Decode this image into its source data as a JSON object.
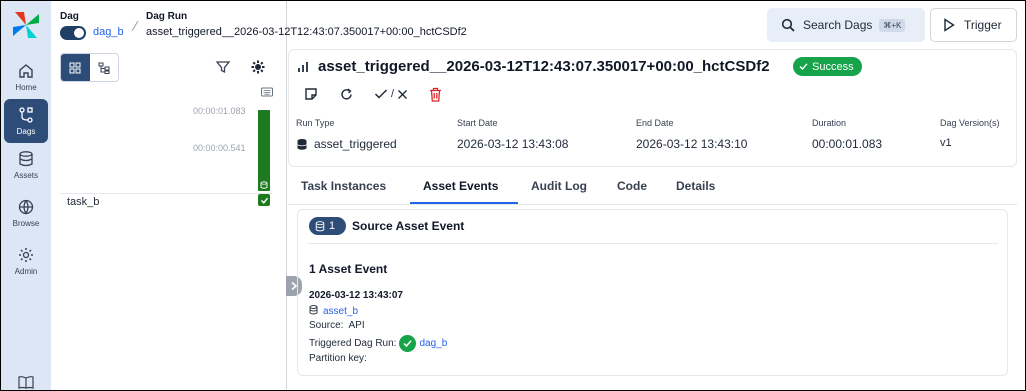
{
  "nav": {
    "items": [
      {
        "label": "Home",
        "icon": "home-icon"
      },
      {
        "label": "Dags",
        "icon": "dags-icon"
      },
      {
        "label": "Assets",
        "icon": "database-icon"
      },
      {
        "label": "Browse",
        "icon": "globe-icon"
      },
      {
        "label": "Admin",
        "icon": "gear-icon"
      }
    ],
    "bottom_icon": "book-icon"
  },
  "breadcrumb": {
    "dag_label": "Dag",
    "dag_name": "dag_b",
    "run_label": "Dag Run",
    "run_id": "asset_triggered__2026-03-12T12:43:07.350017+00:00_hctCSDf2"
  },
  "grid": {
    "durations": [
      "00:00:01.083",
      "00:00:00.541"
    ],
    "tasks": [
      {
        "name": "task_b",
        "state": "success"
      }
    ]
  },
  "topbar": {
    "search_label": "Search Dags",
    "search_shortcut": "⌘+K",
    "trigger_label": "Trigger"
  },
  "run": {
    "title": "asset_triggered__2026-03-12T12:43:07.350017+00:00_hctCSDf2",
    "state": "Success",
    "actions_separator": "/",
    "columns": {
      "run_type": "Run Type",
      "start_date": "Start Date",
      "end_date": "End Date",
      "duration": "Duration",
      "dag_version": "Dag Version(s)"
    },
    "values": {
      "run_type": "asset_triggered",
      "start_date": "2026-03-12 13:43:08",
      "end_date": "2026-03-12 13:43:10",
      "duration": "00:00:01.083",
      "dag_version": "v1"
    }
  },
  "tabs": [
    {
      "label": "Task Instances",
      "active": false
    },
    {
      "label": "Asset Events",
      "active": true
    },
    {
      "label": "Audit Log",
      "active": false
    },
    {
      "label": "Code",
      "active": false
    },
    {
      "label": "Details",
      "active": false
    }
  ],
  "source_events": {
    "count": "1",
    "title": "Source Asset Event",
    "events_count_label": "1 Asset Event",
    "event": {
      "timestamp": "2026-03-12 13:43:07",
      "asset": "asset_b",
      "source_label": "Source:",
      "source_value": "API",
      "triggered_label": "Triggered Dag Run:",
      "triggered_dag": "dag_b",
      "partition_label": "Partition key:"
    }
  },
  "colors": {
    "nav_bg": "#dde6f4",
    "nav_active": "#2d4d78",
    "success": "#16a34a",
    "link": "#2563eb"
  }
}
